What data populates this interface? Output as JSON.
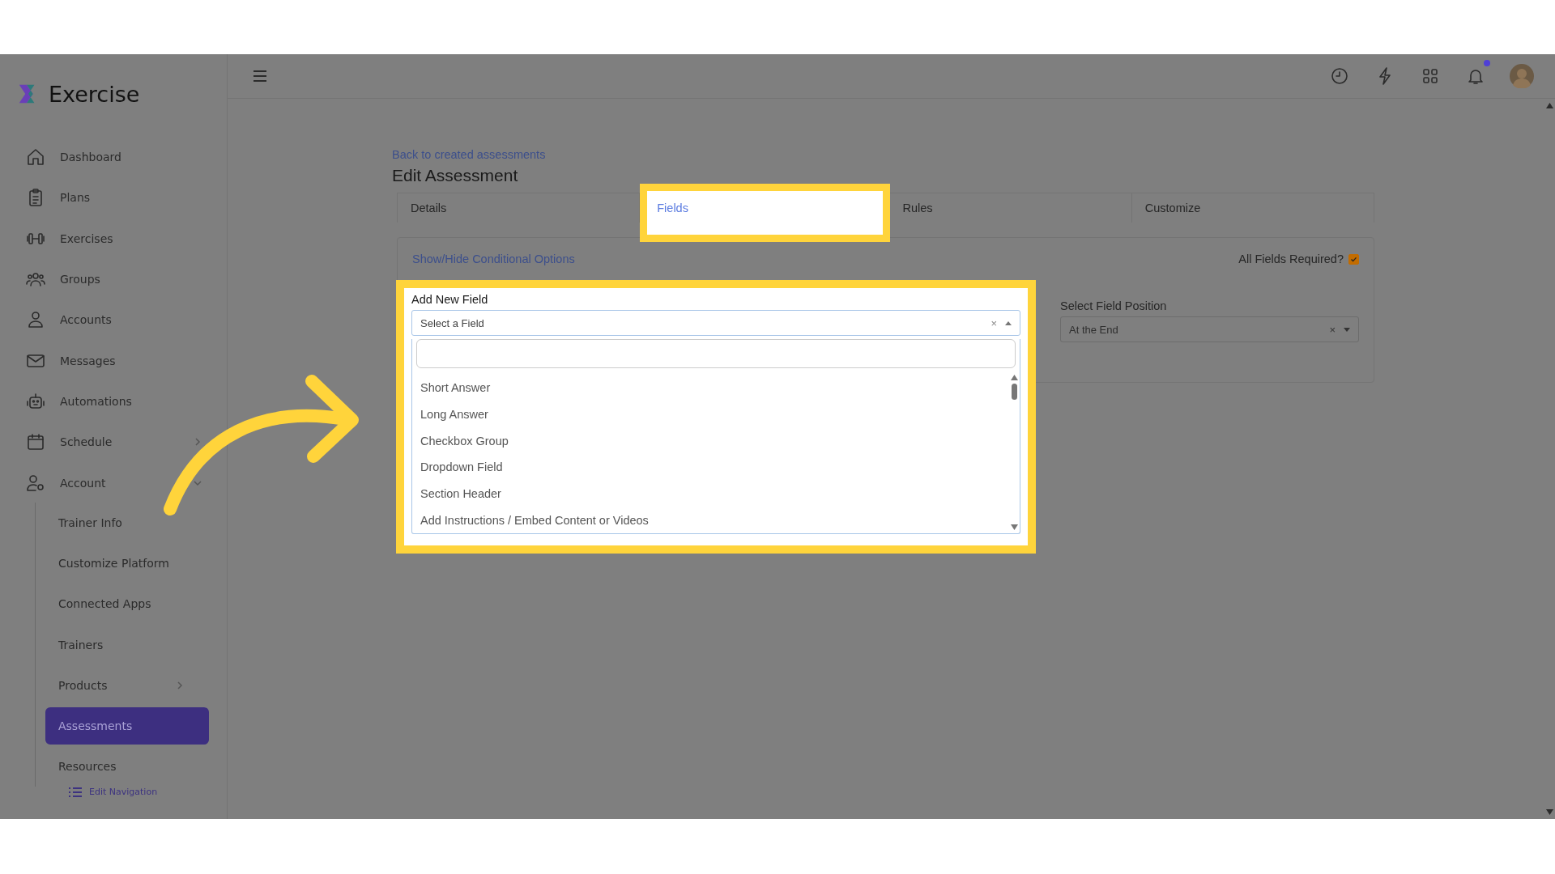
{
  "brand": {
    "name": "Exercise"
  },
  "sidebar": {
    "items": [
      {
        "label": "Dashboard",
        "selected": false
      },
      {
        "label": "Plans",
        "selected": false
      },
      {
        "label": "Exercises",
        "selected": false
      },
      {
        "label": "Groups",
        "selected": false
      },
      {
        "label": "Accounts",
        "selected": false
      },
      {
        "label": "Messages",
        "selected": false
      },
      {
        "label": "Automations",
        "selected": false
      },
      {
        "label": "Schedule",
        "selected": false,
        "has_submenu": true
      },
      {
        "label": "Account",
        "selected": false,
        "expanded": true,
        "children": [
          {
            "label": "Trainer Info",
            "selected": false
          },
          {
            "label": "Customize Platform",
            "selected": false
          },
          {
            "label": "Connected Apps",
            "selected": false
          },
          {
            "label": "Trainers",
            "selected": false
          },
          {
            "label": "Products",
            "selected": false,
            "has_submenu": true
          },
          {
            "label": "Assessments",
            "selected": true
          },
          {
            "label": "Resources",
            "selected": false
          }
        ]
      }
    ],
    "edit_navigation": "Edit Navigation"
  },
  "topbar": {
    "notification_unread": true
  },
  "page": {
    "back_link": "Back to created assessments",
    "title": "Edit Assessment"
  },
  "tabs": [
    {
      "label": "Details",
      "selected": false,
      "highlighted": false
    },
    {
      "label": "Fields",
      "selected": true,
      "highlighted": true
    },
    {
      "label": "Rules",
      "selected": false,
      "highlighted": false
    },
    {
      "label": "Customize",
      "selected": false,
      "highlighted": false
    }
  ],
  "conditional_link": "Show/Hide Conditional Options",
  "all_required": {
    "label": "All Fields Required?",
    "checked": true
  },
  "add_field": {
    "label": "Add New Field",
    "placeholder": "Select a Field",
    "clear": "×",
    "expanded": true,
    "highlighted": true,
    "options": [
      "Short Answer",
      "Long Answer",
      "Checkbox Group",
      "Dropdown Field",
      "Section Header",
      "Add Instructions / Embed Content or Videos"
    ]
  },
  "position": {
    "label": "Select Field Position",
    "value": "At the End",
    "clear": "×"
  }
}
